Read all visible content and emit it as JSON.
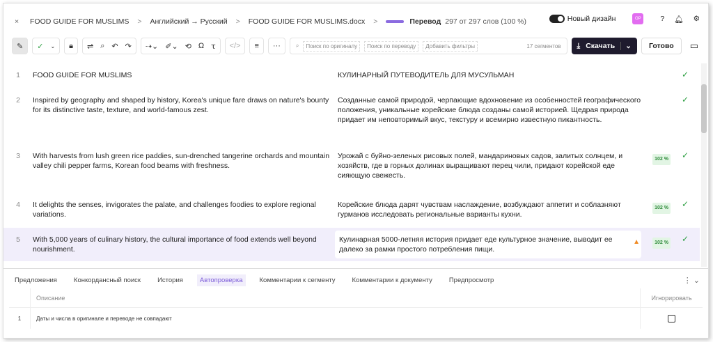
{
  "header": {
    "close": "×",
    "project": "FOOD GUIDE FOR MUSLIMS",
    "langs": "Английский → Русский",
    "file": "FOOD GUIDE FOR MUSLIMS.docx",
    "stage": "Перевод",
    "progress_text": "297 от 297 слов  (100 %)",
    "progress_pct": 100,
    "new_design": "Новый дизайн",
    "avatar": "OP"
  },
  "toolbar": {
    "search_source": "Поиск по оригиналу",
    "search_target": "Поиск по переводу",
    "add_filters": "Добавить фильтры",
    "segments": "17 сегментов",
    "download": "Скачать",
    "done": "Готово"
  },
  "segments": [
    {
      "n": "1",
      "source": "FOOD GUIDE FOR MUSLIMS",
      "target": "КУЛИНАРНЫЙ ПУТЕВОДИТЕЛЬ ДЛЯ МУСУЛЬМАН",
      "match": null
    },
    {
      "n": "2",
      "source": "Inspired by geography and shaped by history, Korea's unique fare draws on nature's bounty for its distinctive taste, texture, and world-famous zest.",
      "target": "Созданные самой природой, черпающие вдохновение из особенностей географического положения, уникальные корейские блюда созданы самой историей. Щедрая природа придает им неповторимый вкус, текстуру и всемирно известную пикантность.",
      "match": null
    },
    {
      "n": "3",
      "source": "With harvests from lush green rice paddies, sun-drenched tangerine orchards and mountain valley chili pepper farms, Korean food beams with freshness.",
      "target": "Урожай с буйно-зеленых рисовых полей, мандариновых садов, залитых солнцем, и хозяйств, где в горных долинах выращивают перец чили, придают корейской еде сияющую свежесть.",
      "match": "102 %"
    },
    {
      "n": "4",
      "source": "It delights the senses, invigorates the palate, and challenges foodies to explore regional variations.",
      "target": "Корейские блюда дарят чувствам наслаждение, возбуждают аппетит и соблазняют гурманов исследовать региональные варианты кухни.",
      "match": "102 %"
    },
    {
      "n": "5",
      "source": "With 5,000 years of culinary history, the cultural importance of food extends well beyond nourishment.",
      "target": "Кулинарная 5000-летняя история придает еде культурное значение, выводит ее далеко за рамки простого потребления пищи.",
      "match": "102 %"
    }
  ],
  "panel": {
    "tabs": [
      "Предложения",
      "Конкордансный поиск",
      "История",
      "Автопроверка",
      "Комментарии к сегменту",
      "Комментарии к документу",
      "Предпросмотр"
    ],
    "col_desc": "Описание",
    "col_ignore": "Игнорировать",
    "issues": [
      {
        "n": "1",
        "text": "Даты и числа в оригинале и переводе не совпадают"
      }
    ]
  }
}
